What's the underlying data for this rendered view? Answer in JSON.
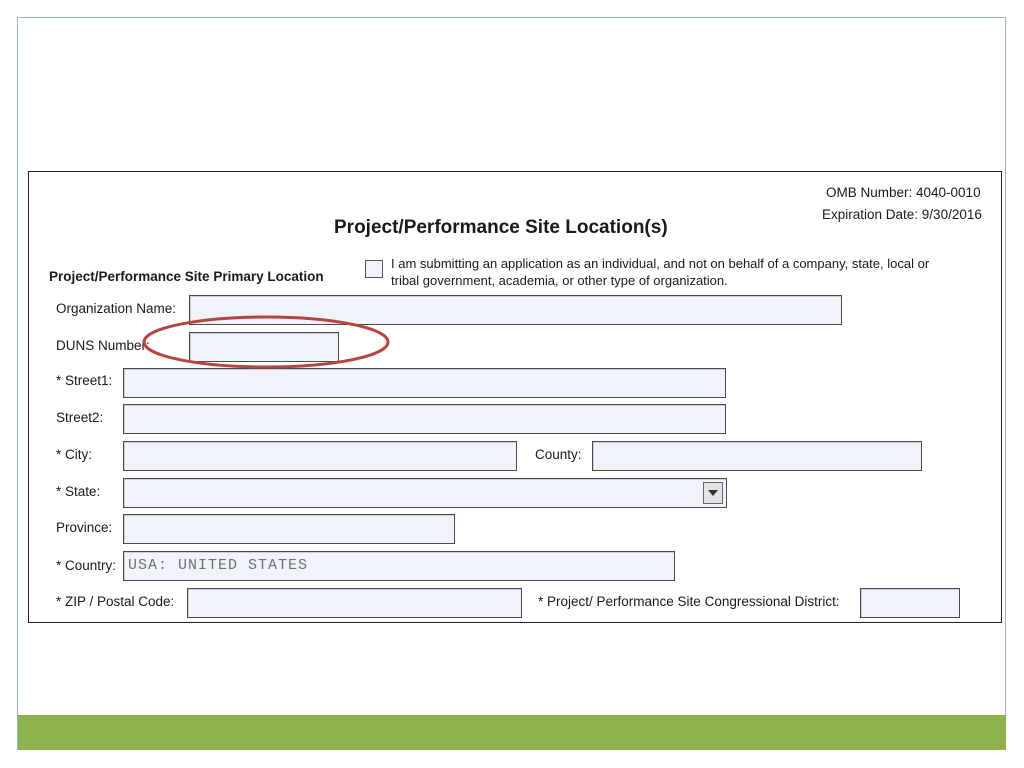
{
  "form": {
    "omb_number": "OMB Number: 4040-0010",
    "expiration_date": "Expiration Date: 9/30/2016",
    "title": "Project/Performance Site Location(s)",
    "section_label": "Project/Performance Site Primary Location",
    "individual_checkbox_text": "I am submitting an application as an individual, and not on behalf of a company, state, local or tribal government, academia, or other type of organization.",
    "individual_checked": false,
    "fields": {
      "organization_name": {
        "label": "Organization Name:",
        "value": ""
      },
      "duns_number": {
        "label": "DUNS Number:",
        "value": ""
      },
      "street1": {
        "label": "* Street1:",
        "value": ""
      },
      "street2": {
        "label": "Street2:",
        "value": ""
      },
      "city": {
        "label": "* City:",
        "value": ""
      },
      "county": {
        "label": "County:",
        "value": ""
      },
      "state": {
        "label": "* State:",
        "value": ""
      },
      "province": {
        "label": "Province:",
        "value": ""
      },
      "country": {
        "label": "* Country:",
        "value": "USA: UNITED STATES"
      },
      "zip": {
        "label": "* ZIP / Postal Code:",
        "value": ""
      },
      "congressional_district": {
        "label": "* Project/ Performance Site Congressional District:",
        "value": ""
      }
    }
  },
  "colors": {
    "field_fill": "#f1f3fb",
    "annotation_ellipse": "#b5463f",
    "footer_bar": "#8db24e"
  }
}
